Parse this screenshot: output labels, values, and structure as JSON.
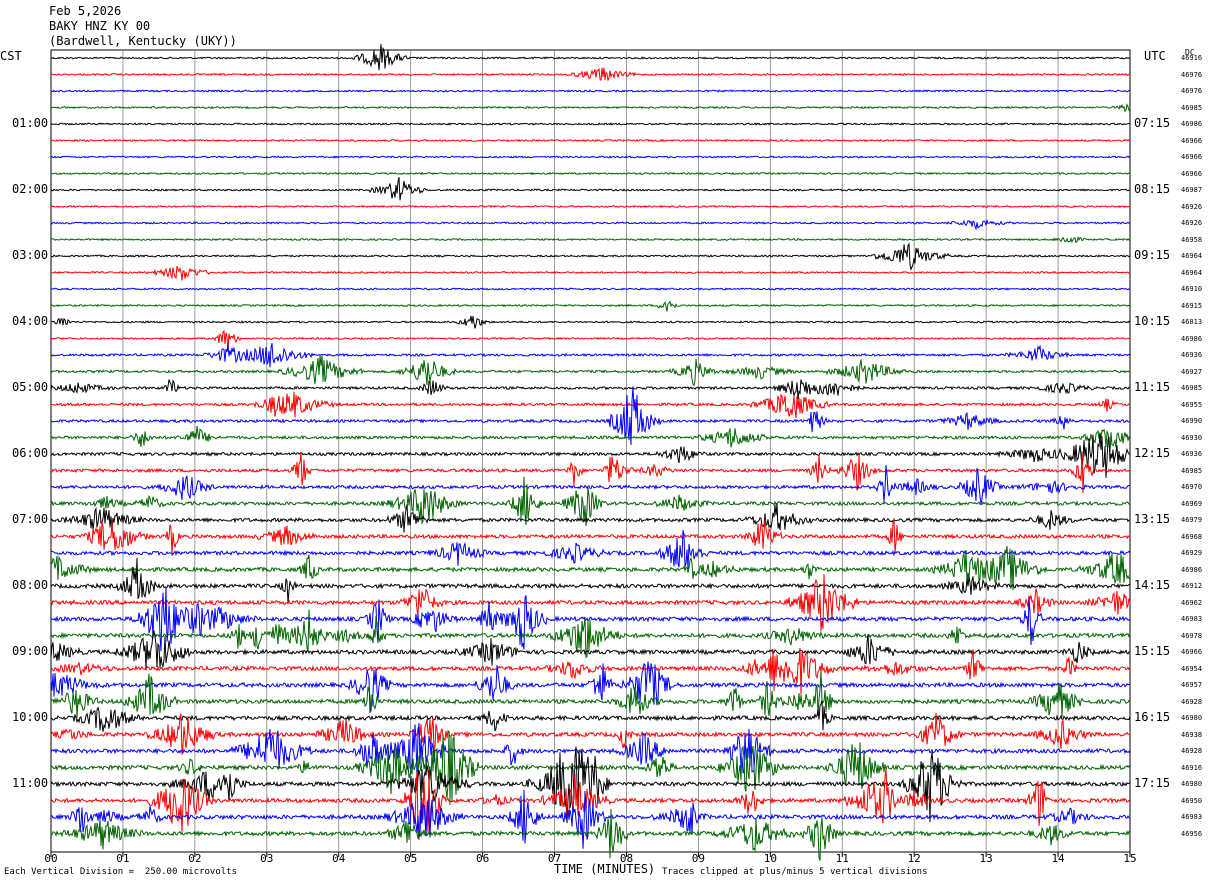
{
  "header": {
    "date": "Feb 5,2026",
    "station": "BAKY HNZ KY 00",
    "location": "(Bardwell, Kentucky (UKY))"
  },
  "left_timezone": "CST",
  "right_timezone": "UTC",
  "dc_label": "DC",
  "footer": {
    "scale": "Each Vertical Division =  250.00 microvolts",
    "xlabel": "TIME (MINUTES)",
    "clip_note": "Traces clipped at plus/minus 5 vertical divisions"
  },
  "colors": {
    "black": "#000000",
    "red": "#ff0000",
    "blue": "#0000ff",
    "green": "#006400",
    "grid": "#808080"
  },
  "chart_data": {
    "type": "line",
    "title": "BAKY HNZ KY 00",
    "xlabel": "TIME (MINUTES)",
    "xlim": [
      0,
      15
    ],
    "x_ticks": [
      "00",
      "01",
      "02",
      "03",
      "04",
      "05",
      "06",
      "07",
      "08",
      "09",
      "10",
      "11",
      "12",
      "13",
      "14",
      "15"
    ],
    "trace_count": 48,
    "trace_interval_minutes": 15,
    "trace_color_cycle": [
      "black",
      "red",
      "blue",
      "green"
    ],
    "cst_labels": [
      "01:00",
      "02:00",
      "03:00",
      "04:00",
      "05:00",
      "06:00",
      "07:00",
      "08:00",
      "09:00",
      "10:00",
      "11:00"
    ],
    "utc_labels": [
      "07:15",
      "08:15",
      "09:15",
      "10:15",
      "11:15",
      "12:15",
      "13:15",
      "14:15",
      "15:15",
      "16:15",
      "17:15"
    ],
    "dc_offsets": [
      "46916",
      "46976",
      "46976",
      "46985",
      "46986",
      "46966",
      "46966",
      "46966",
      "46987",
      "46926",
      "46926",
      "46958",
      "46964",
      "46964",
      "46910",
      "46915",
      "46813",
      "46986",
      "46936",
      "46927",
      "46985",
      "46955",
      "46990",
      "46930",
      "46936",
      "46985",
      "46970",
      "46969",
      "46979",
      "46968",
      "46929",
      "46986",
      "46912",
      "46962",
      "46983",
      "46978",
      "46966",
      "46954",
      "46957",
      "46928",
      "46980",
      "46938",
      "46928",
      "46916",
      "46980",
      "46950",
      "46983",
      "46956"
    ]
  }
}
